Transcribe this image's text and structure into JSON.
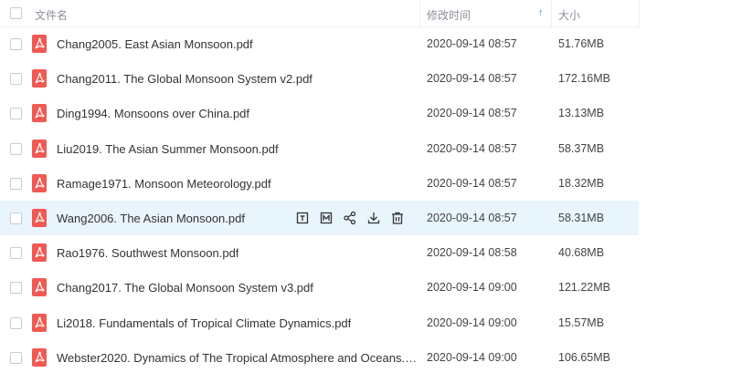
{
  "header": {
    "name_label": "文件名",
    "modified_label": "修改时间",
    "size_label": "大小",
    "sort_indicator": "↑"
  },
  "files": [
    {
      "name": "Chang2005. East Asian Monsoon.pdf",
      "modified": "2020-09-14 08:57",
      "size": "51.76MB"
    },
    {
      "name": "Chang2011. The Global Monsoon System v2.pdf",
      "modified": "2020-09-14 08:57",
      "size": "172.16MB"
    },
    {
      "name": "Ding1994. Monsoons over China.pdf",
      "modified": "2020-09-14 08:57",
      "size": "13.13MB"
    },
    {
      "name": "Liu2019. The Asian Summer Monsoon.pdf",
      "modified": "2020-09-14 08:57",
      "size": "58.37MB"
    },
    {
      "name": "Ramage1971. Monsoon Meteorology.pdf",
      "modified": "2020-09-14 08:57",
      "size": "18.32MB"
    },
    {
      "name": "Wang2006. The Asian Monsoon.pdf",
      "modified": "2020-09-14 08:57",
      "size": "58.31MB",
      "hovered": true
    },
    {
      "name": "Rao1976. Southwest Monsoon.pdf",
      "modified": "2020-09-14 08:58",
      "size": "40.68MB"
    },
    {
      "name": "Chang2017. The Global Monsoon System v3.pdf",
      "modified": "2020-09-14 09:00",
      "size": "121.22MB"
    },
    {
      "name": "Li2018. Fundamentals of Tropical Climate Dynamics.pdf",
      "modified": "2020-09-14 09:00",
      "size": "15.57MB"
    },
    {
      "name": "Webster2020. Dynamics of The Tropical Atmosphere and Oceans.p...",
      "modified": "2020-09-14 09:00",
      "size": "106.65MB"
    }
  ],
  "row_actions": [
    "preview-icon",
    "save-icon",
    "share-icon",
    "download-icon",
    "delete-icon"
  ],
  "colors": {
    "accent": "#1e90ff",
    "pdf": "#f05a52",
    "hover_row": "#e9f5fd"
  }
}
